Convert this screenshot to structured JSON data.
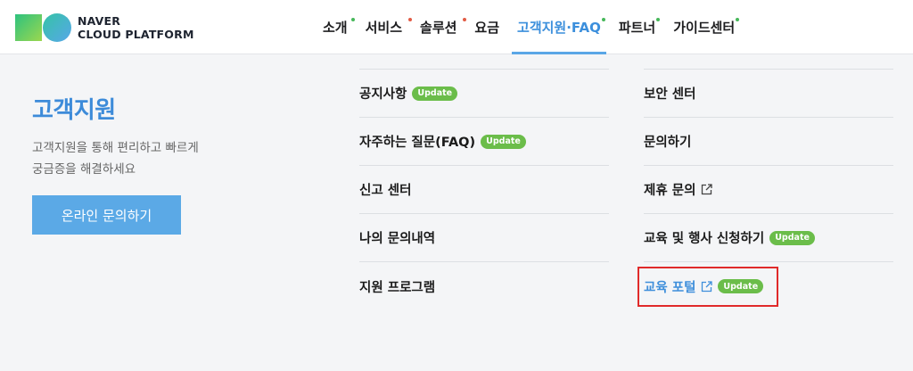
{
  "header": {
    "logo_line1": "NAVER",
    "logo_line2": "CLOUD PLATFORM",
    "nav": [
      {
        "label": "소개",
        "dot": "#47b85a",
        "active": false
      },
      {
        "label": "서비스",
        "dot": "#e25b45",
        "active": false
      },
      {
        "label": "솔루션",
        "dot": "#e25b45",
        "active": false
      },
      {
        "label": "요금",
        "dot": "",
        "active": false
      },
      {
        "label": "고객지원·FAQ",
        "dot": "#47b85a",
        "active": true
      },
      {
        "label": "파트너",
        "dot": "#47b85a",
        "active": false
      },
      {
        "label": "가이드센터",
        "dot": "#47b85a",
        "active": false
      }
    ]
  },
  "left": {
    "title": "고객지원",
    "desc_line1": "고객지원을 통해 편리하고 빠르게",
    "desc_line2": "궁금증을 해결하세요",
    "cta": "온라인 문의하기"
  },
  "col1": [
    {
      "label": "공지사항",
      "badge": "Update"
    },
    {
      "label": "자주하는 질문(FAQ)",
      "badge": "Update"
    },
    {
      "label": "신고 센터"
    },
    {
      "label": "나의 문의내역"
    },
    {
      "label": "지원 프로그램"
    }
  ],
  "col2": [
    {
      "label": "보안 센터"
    },
    {
      "label": "문의하기"
    },
    {
      "label": "제휴 문의",
      "external": true
    },
    {
      "label": "교육 및 행사 신청하기",
      "badge": "Update"
    },
    {
      "label": "교육 포털",
      "external": true,
      "badge": "Update",
      "highlight": true
    }
  ],
  "colors": {
    "accent": "#3d8bd9",
    "badge": "#6bbd4a",
    "highlight_border": "#e02a2a"
  }
}
